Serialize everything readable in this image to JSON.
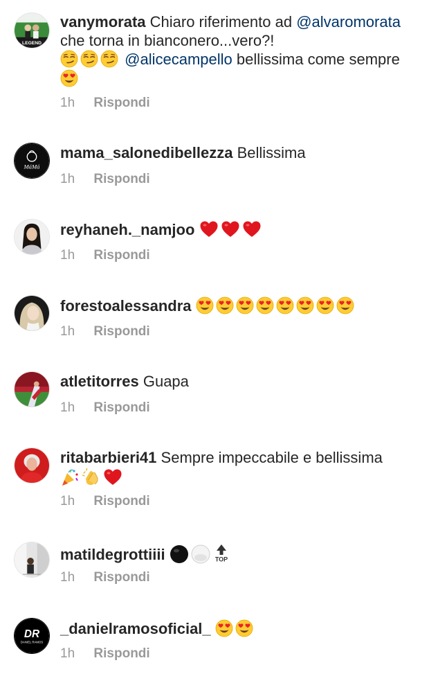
{
  "comments": [
    {
      "username": "vanymorata",
      "text_1": "Chiaro riferimento ad",
      "mention_1": "@alvaromorata",
      "text_2": "che torna in bianconero...vero?!",
      "mention_2": "@alicecampello",
      "text_3": "bellissima come sempre",
      "emoji": [
        "smirking-face",
        "smirking-face",
        "smirking-face",
        "heart-eyes-face"
      ],
      "time": "1h",
      "reply": "Rispondi",
      "avatar_text": "LEGEND"
    },
    {
      "username": "mama_salonedibellezza",
      "text": "Bellissima",
      "time": "1h",
      "reply": "Rispondi",
      "avatar_text": "MáMá"
    },
    {
      "username": "reyhaneh._namjoo",
      "text": "",
      "emoji": [
        "red-heart",
        "red-heart",
        "red-heart"
      ],
      "time": "1h",
      "reply": "Rispondi"
    },
    {
      "username": "forestoalessandra",
      "text": "",
      "emoji": [
        "heart-eyes-face",
        "heart-eyes-face",
        "heart-eyes-face",
        "heart-eyes-face",
        "heart-eyes-face",
        "heart-eyes-face",
        "heart-eyes-face",
        "heart-eyes-face"
      ],
      "time": "1h",
      "reply": "Rispondi"
    },
    {
      "username": "atletitorres",
      "text": "Guapa",
      "time": "1h",
      "reply": "Rispondi"
    },
    {
      "username": "ritabarbieri41",
      "text": "Sempre impeccabile e bellissima",
      "emoji": [
        "party-popper",
        "clapping-hands",
        "red-heart"
      ],
      "time": "1h",
      "reply": "Rispondi"
    },
    {
      "username": "matildegrottiiii",
      "text": "",
      "emoji": [
        "black-circle",
        "white-circle",
        "top-arrow"
      ],
      "top_label": "TOP",
      "time": "1h",
      "reply": "Rispondi"
    },
    {
      "username": "_danielramosoficial_",
      "text": "",
      "emoji": [
        "heart-eyes-face",
        "heart-eyes-face"
      ],
      "time": "1h",
      "reply": "Rispondi",
      "avatar_text": "DR",
      "avatar_subtext": "DANIEL RAMOS"
    }
  ],
  "colors": {
    "text": "#262626",
    "mention": "#003569",
    "meta": "#999999"
  }
}
